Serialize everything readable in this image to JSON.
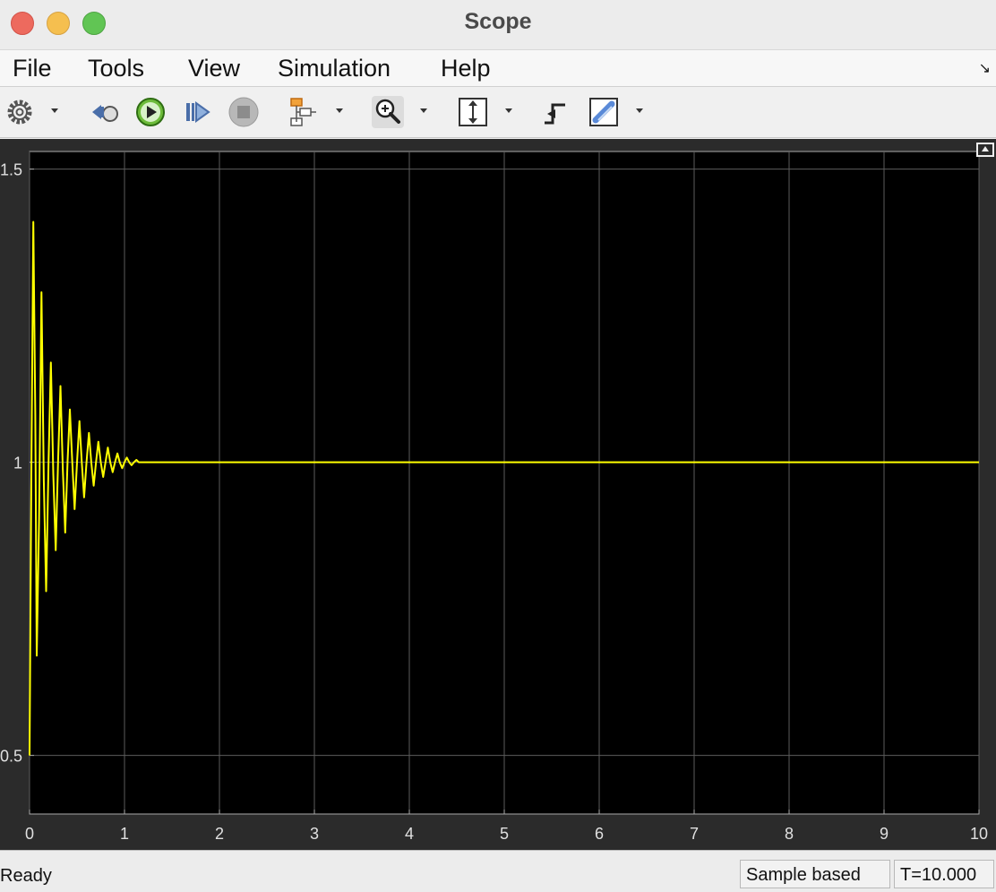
{
  "window": {
    "title": "Scope"
  },
  "menu": {
    "items": [
      "File",
      "Tools",
      "View",
      "Simulation",
      "Help"
    ]
  },
  "toolbar": {
    "icons": [
      "gear-icon",
      "step-back-icon",
      "run-icon",
      "step-forward-icon",
      "stop-icon",
      "signal-layout-icon",
      "zoom-in-icon",
      "autoscale-icon",
      "trigger-icon",
      "highlight-icon"
    ]
  },
  "status": {
    "text": "Ready",
    "mode": "Sample based",
    "time": "T=10.000"
  },
  "chart_data": {
    "type": "line",
    "title": "",
    "xlabel": "",
    "ylabel": "",
    "xlim": [
      0,
      10
    ],
    "ylim": [
      0.4,
      1.53
    ],
    "xticks": [
      0,
      1,
      2,
      3,
      4,
      5,
      6,
      7,
      8,
      9,
      10
    ],
    "yticks": [
      0.5,
      1,
      1.5
    ],
    "ytick_labels": [
      "0.5",
      "1",
      "1.5"
    ],
    "grid": true,
    "background": "#000000",
    "line_color": "#ffff00",
    "series": [
      {
        "name": "",
        "x": [
          0.0,
          0.02,
          0.04,
          0.06,
          0.075,
          0.1,
          0.125,
          0.15,
          0.175,
          0.2,
          0.225,
          0.25,
          0.275,
          0.3,
          0.325,
          0.35,
          0.375,
          0.4,
          0.425,
          0.45,
          0.475,
          0.5,
          0.525,
          0.55,
          0.575,
          0.6,
          0.625,
          0.65,
          0.675,
          0.7,
          0.725,
          0.75,
          0.775,
          0.8,
          0.825,
          0.85,
          0.875,
          0.9,
          0.925,
          0.95,
          0.975,
          1.0,
          1.025,
          1.05,
          1.075,
          1.1,
          1.125,
          1.15,
          1.2,
          1.3,
          1.4,
          1.5,
          1.7,
          2.0,
          3.0,
          5.0,
          7.0,
          10.0
        ],
        "values": [
          0.5,
          1.0,
          1.41,
          1.08,
          0.67,
          0.9,
          1.29,
          0.97,
          0.78,
          1.0,
          1.17,
          0.98,
          0.85,
          1.0,
          1.13,
          0.99,
          0.88,
          1.0,
          1.09,
          1.0,
          0.92,
          1.0,
          1.07,
          1.0,
          0.94,
          1.0,
          1.05,
          1.0,
          0.96,
          1.0,
          1.035,
          1.0,
          0.975,
          1.0,
          1.025,
          1.0,
          0.983,
          1.0,
          1.015,
          1.0,
          0.99,
          1.0,
          1.008,
          1.0,
          0.995,
          1.0,
          1.004,
          1.0,
          1.0,
          1.0,
          1.0,
          1.0,
          1.0,
          1.0,
          1.0,
          1.0,
          1.0,
          1.0
        ]
      }
    ]
  }
}
